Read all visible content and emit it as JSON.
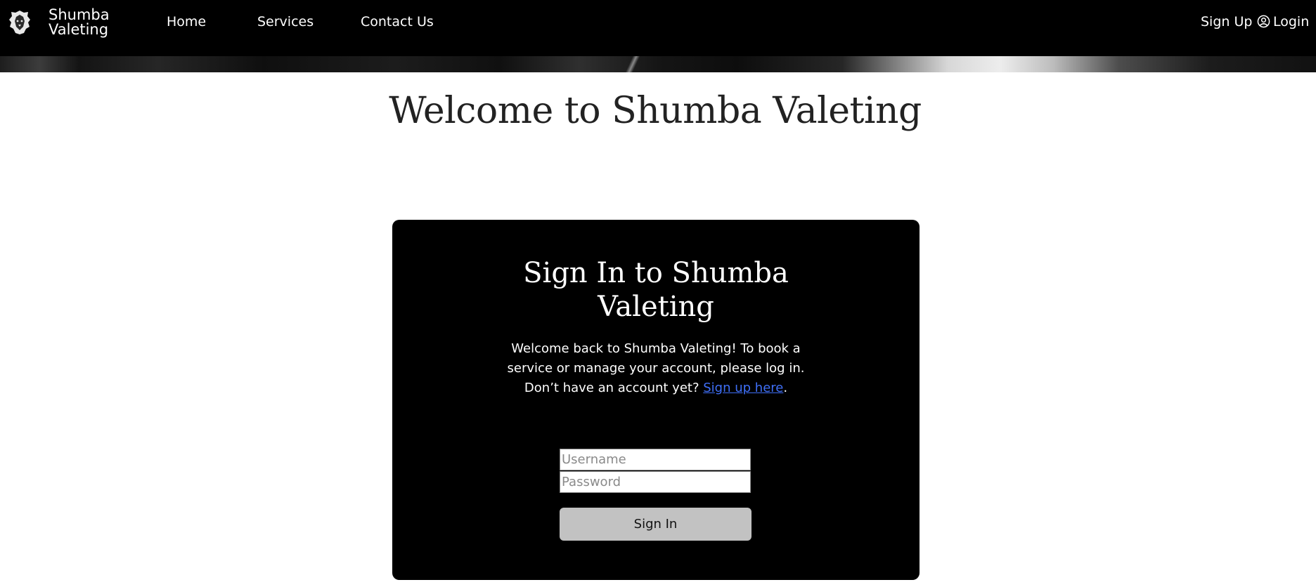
{
  "brand": {
    "line1": "Shumba",
    "line2": "Valeting",
    "logo_icon": "lion-head-icon"
  },
  "nav": {
    "links": [
      {
        "label": "Home"
      },
      {
        "label": "Services"
      },
      {
        "label": "Contact Us"
      }
    ],
    "signup_label": "Sign Up",
    "login_label": "Login",
    "login_icon": "user-circle-icon"
  },
  "main": {
    "title": "Welcome to Shumba Valeting"
  },
  "signin": {
    "title_line1": "Sign In to Shumba",
    "title_line2": "Valeting",
    "intro": "Welcome back to Shumba Valeting! To book a service or manage your account, please log in. Don’t have an account yet?",
    "signup_link": "Sign up here",
    "signup_suffix": ".",
    "username_placeholder": "Username",
    "password_placeholder": "Password",
    "button_label": "Sign In"
  },
  "colors": {
    "nav_bg": "#000000",
    "card_bg": "#000000",
    "link": "#3f6ff7",
    "button_bg": "#c2c2c2"
  }
}
